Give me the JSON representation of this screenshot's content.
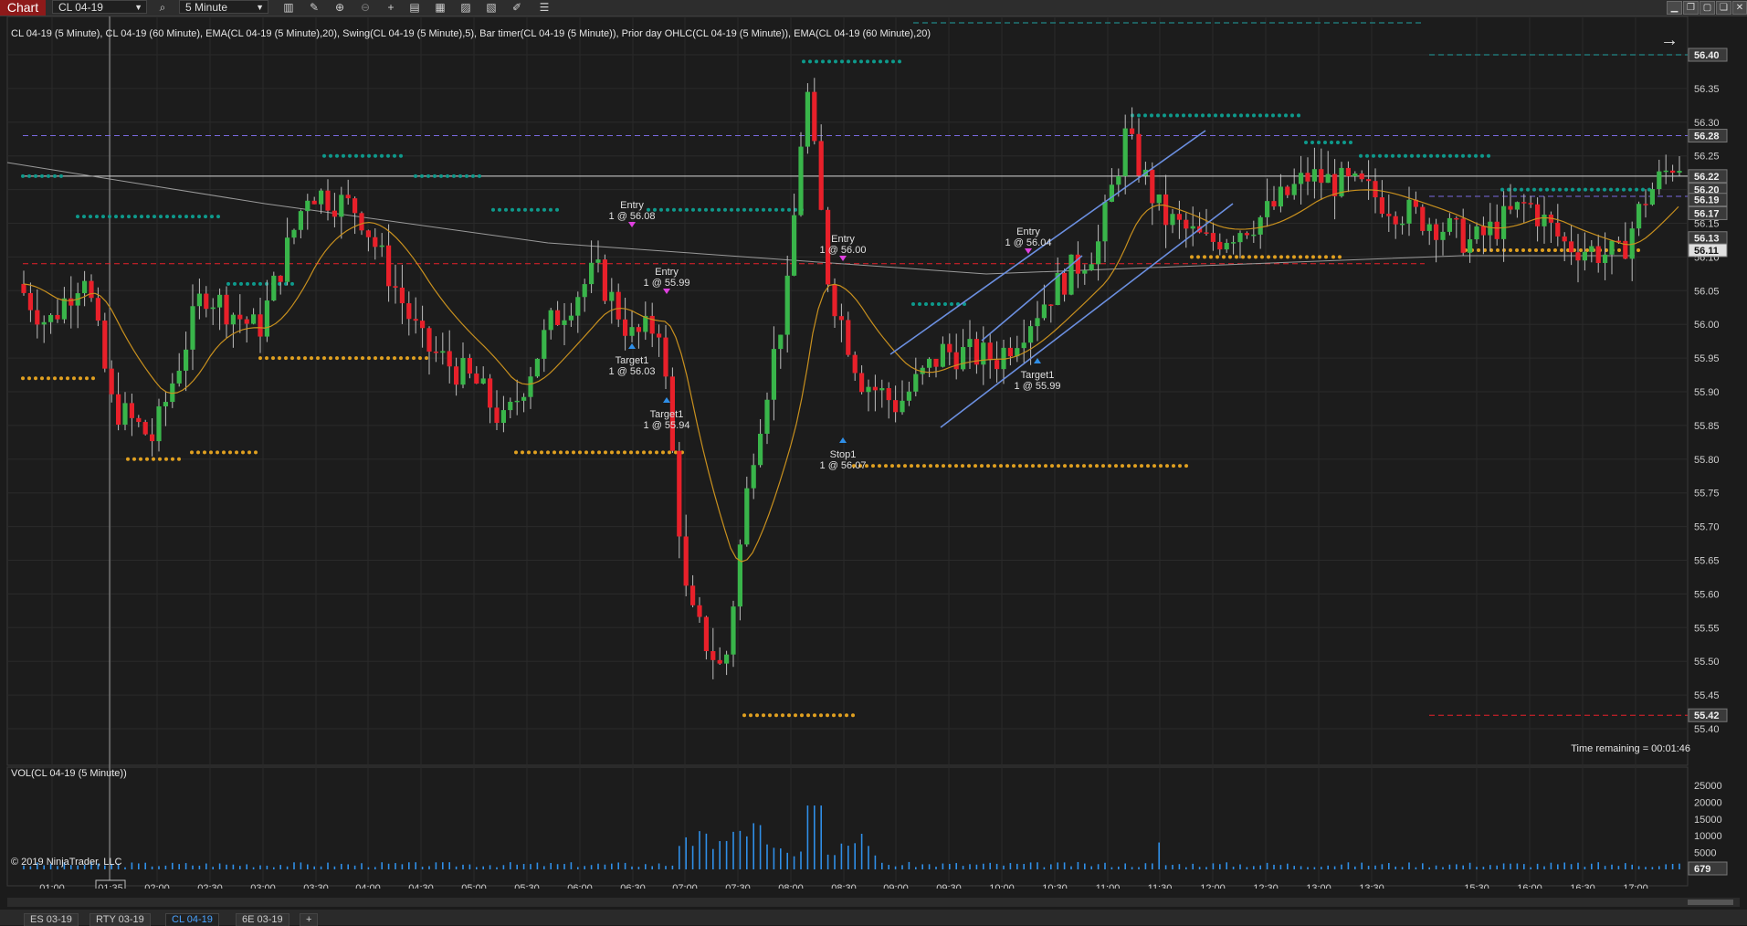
{
  "toolbar": {
    "tab_label": "Chart",
    "instrument": "CL 04-19",
    "interval": "5 Minute",
    "icons": [
      "search-icon",
      "bar-style-icon",
      "pencil-icon",
      "zoom-in-icon",
      "zoom-out-icon",
      "crosshair-icon",
      "properties-icon",
      "templates-icon",
      "strategies-icon",
      "indicators-icon",
      "drawing-tools-icon",
      "list-icon"
    ],
    "window_buttons": [
      "minimize",
      "restore",
      "close"
    ]
  },
  "chart": {
    "indicator_label": "CL 04-19 (5 Minute), CL 04-19 (60 Minute), EMA(CL 04-19 (5 Minute),20), Swing(CL 04-19 (5 Minute),5), Bar timer(CL 04-19 (5 Minute)), Prior day OHLC(CL 04-19 (5 Minute)), EMA(CL 04-19 (60 Minute),20)",
    "time_remaining": "Time remaining = 00:01:46",
    "copyright": "© 2019 NinjaTrader, LLC",
    "volume_label": "VOL(CL 04-19 (5 Minute))",
    "crosshair_time": "01:35",
    "colors": {
      "bull": "#39b54a",
      "bear": "#e8202a",
      "ema": "#c8901e",
      "swing_high": "#0e9a8c",
      "swing_low": "#e0a020",
      "trend": "#6b8fe0",
      "volume": "#2f8fe8"
    }
  },
  "chart_data": {
    "type": "candlestick",
    "price_axis": {
      "ticks": [
        "56.40",
        "56.35",
        "56.30",
        "56.25",
        "56.20",
        "56.15",
        "56.10",
        "56.05",
        "56.00",
        "55.95",
        "55.90",
        "55.85",
        "55.80",
        "55.75",
        "55.70",
        "55.65",
        "55.60",
        "55.55",
        "55.50",
        "55.45",
        "55.40"
      ],
      "range": [
        55.4,
        56.4
      ]
    },
    "price_markers": [
      "56.40",
      "56.28",
      "56.22",
      "56.20",
      "56.19",
      "56.17",
      "56.13",
      "56.11",
      "55.42"
    ],
    "time_axis": [
      "01:00",
      "01:35",
      "02:00",
      "02:30",
      "03:00",
      "03:30",
      "04:00",
      "04:30",
      "05:00",
      "05:30",
      "06:00",
      "06:30",
      "07:00",
      "07:30",
      "08:00",
      "08:30",
      "09:00",
      "09:30",
      "10:00",
      "10:30",
      "11:00",
      "11:30",
      "12:00",
      "12:30",
      "13:00",
      "13:30",
      "15:30",
      "16:00",
      "16:30",
      "17:00"
    ],
    "volume_axis": {
      "ticks": [
        "25000",
        "20000",
        "15000",
        "10000",
        "5000"
      ],
      "range": [
        0,
        25000
      ]
    },
    "volume_last": "679",
    "trade_markers": [
      {
        "type": "Entry",
        "line1": "Entry",
        "line2": "1 @ 56.08"
      },
      {
        "type": "Entry",
        "line1": "Entry",
        "line2": "1 @ 55.99"
      },
      {
        "type": "Target",
        "line1": "Target1",
        "line2": "1 @ 56.03"
      },
      {
        "type": "Target",
        "line1": "Target1",
        "line2": "1 @ 55.94"
      },
      {
        "type": "Entry",
        "line1": "Entry",
        "line2": "1 @ 56.00"
      },
      {
        "type": "Stop",
        "line1": "Stop1",
        "line2": "1 @ 56.07"
      },
      {
        "type": "Entry",
        "line1": "Entry",
        "line2": "1 @ 56.04"
      },
      {
        "type": "Target",
        "line1": "Target1",
        "line2": "1 @ 55.99"
      }
    ],
    "swing_highs": [
      56.22,
      56.16,
      56.25,
      56.22,
      56.06,
      56.17,
      56.05,
      56.39,
      56.03,
      56.31,
      56.27,
      56.25,
      56.2,
      56.39
    ],
    "swing_lows": [
      55.92,
      55.8,
      55.81,
      55.95,
      55.81,
      55.42,
      55.79,
      56.1,
      56.11
    ],
    "prior_day_levels": {
      "high": 56.4,
      "open": 56.28,
      "close": 56.19,
      "low": 55.42,
      "red_dashed": 56.09
    }
  },
  "bottom_tabs": [
    "ES 03-19",
    "RTY 03-19",
    "CL 04-19",
    "6E 03-19",
    "+"
  ]
}
